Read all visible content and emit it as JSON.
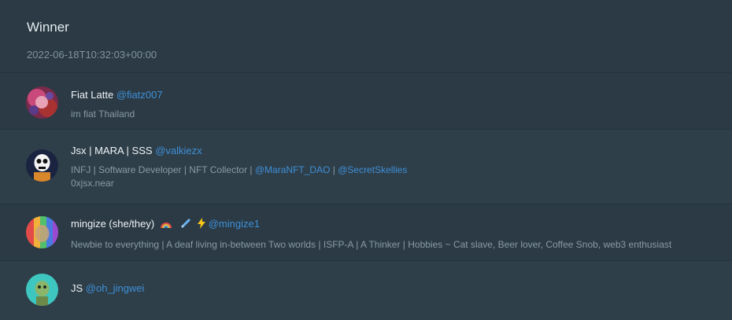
{
  "header": {
    "title": "Winner",
    "date": "2022-06-18T10:32:03+00:00"
  },
  "users": [
    {
      "name": "Fiat Latte",
      "handle": "@fiatz007",
      "bio": "im fiat Thailand"
    },
    {
      "name": "Jsx | MARA | SSS",
      "handle": "@valkiezx",
      "bio_prefix": "INFJ | Software Developer | NFT Collector | ",
      "mention1": "@MaraNFT_DAO",
      "bio_sep": " | ",
      "mention2": "@SecretSkellies",
      "bio_line2": "0xjsx.near"
    },
    {
      "name": "mingize (she/they)",
      "handle": "@mingize1",
      "bio": "Newbie to everything | A deaf living in-between Two worlds | ISFP-A | A Thinker | Hobbies ~ Cat slave, Beer lover, Coffee Snob, web3 enthusiast"
    },
    {
      "name": "JS",
      "handle": "@oh_jingwei"
    }
  ],
  "colors": {
    "background": "#2b3a44",
    "row_alt": "#2f3f49",
    "link": "#3d8fd8",
    "muted": "#8a9aa6"
  },
  "icons": [
    "rainbow-icon",
    "syringe-icon",
    "lightning-icon"
  ]
}
